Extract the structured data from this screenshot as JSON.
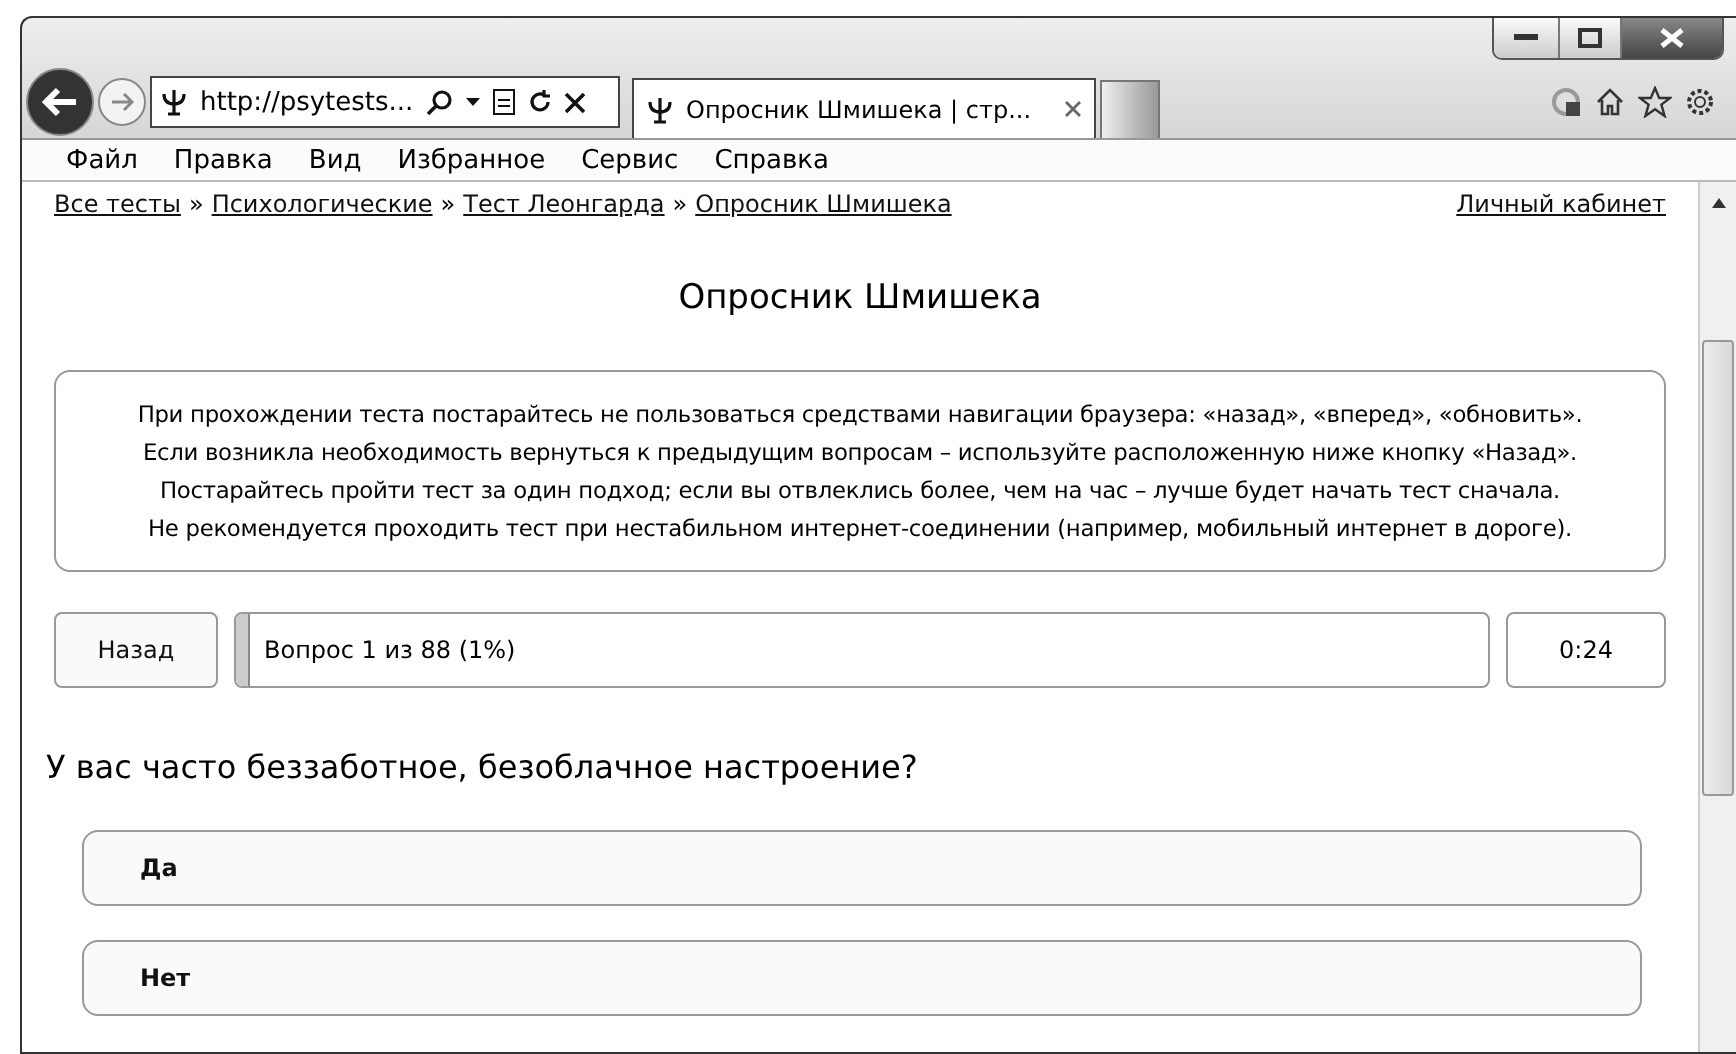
{
  "browser": {
    "address": "http://psytests...",
    "tab_title": "Опросник Шмишека | стр..."
  },
  "menu": [
    {
      "label": "Файл"
    },
    {
      "label": "Правка"
    },
    {
      "label": "Вид"
    },
    {
      "label": "Избранное"
    },
    {
      "label": "Сервис"
    },
    {
      "label": "Справка"
    }
  ],
  "breadcrumbs": [
    "Все тесты",
    "Психологические",
    "Тест Леонгарда",
    "Опросник Шмишека"
  ],
  "breadcrumb_separator": "»",
  "account_link": "Личный кабинет",
  "page_title": "Опросник Шмишека",
  "notice": [
    "При прохождении теста постарайтесь не пользоваться средствами навигации браузера: «назад», «вперед», «обновить».",
    "Если возникла необходимость вернуться к предыдущим вопросам – используйте расположенную ниже кнопку «Назад».",
    "Постарайтесь пройти тест за один подход; если вы отвлеклись более, чем на час – лучше будет начать тест сначала.",
    "Не рекомендуется проходить тест при нестабильном интернет-соединении (например, мобильный интернет в дороге)."
  ],
  "back_button": "Назад",
  "progress": {
    "label": "Вопрос 1 из 88 (1%)",
    "level": 0.01
  },
  "timer": "0:24",
  "question": "У вас часто беззаботное, безоблачное настроение?",
  "answers": [
    {
      "label": "Да"
    },
    {
      "label": "Нет"
    }
  ]
}
